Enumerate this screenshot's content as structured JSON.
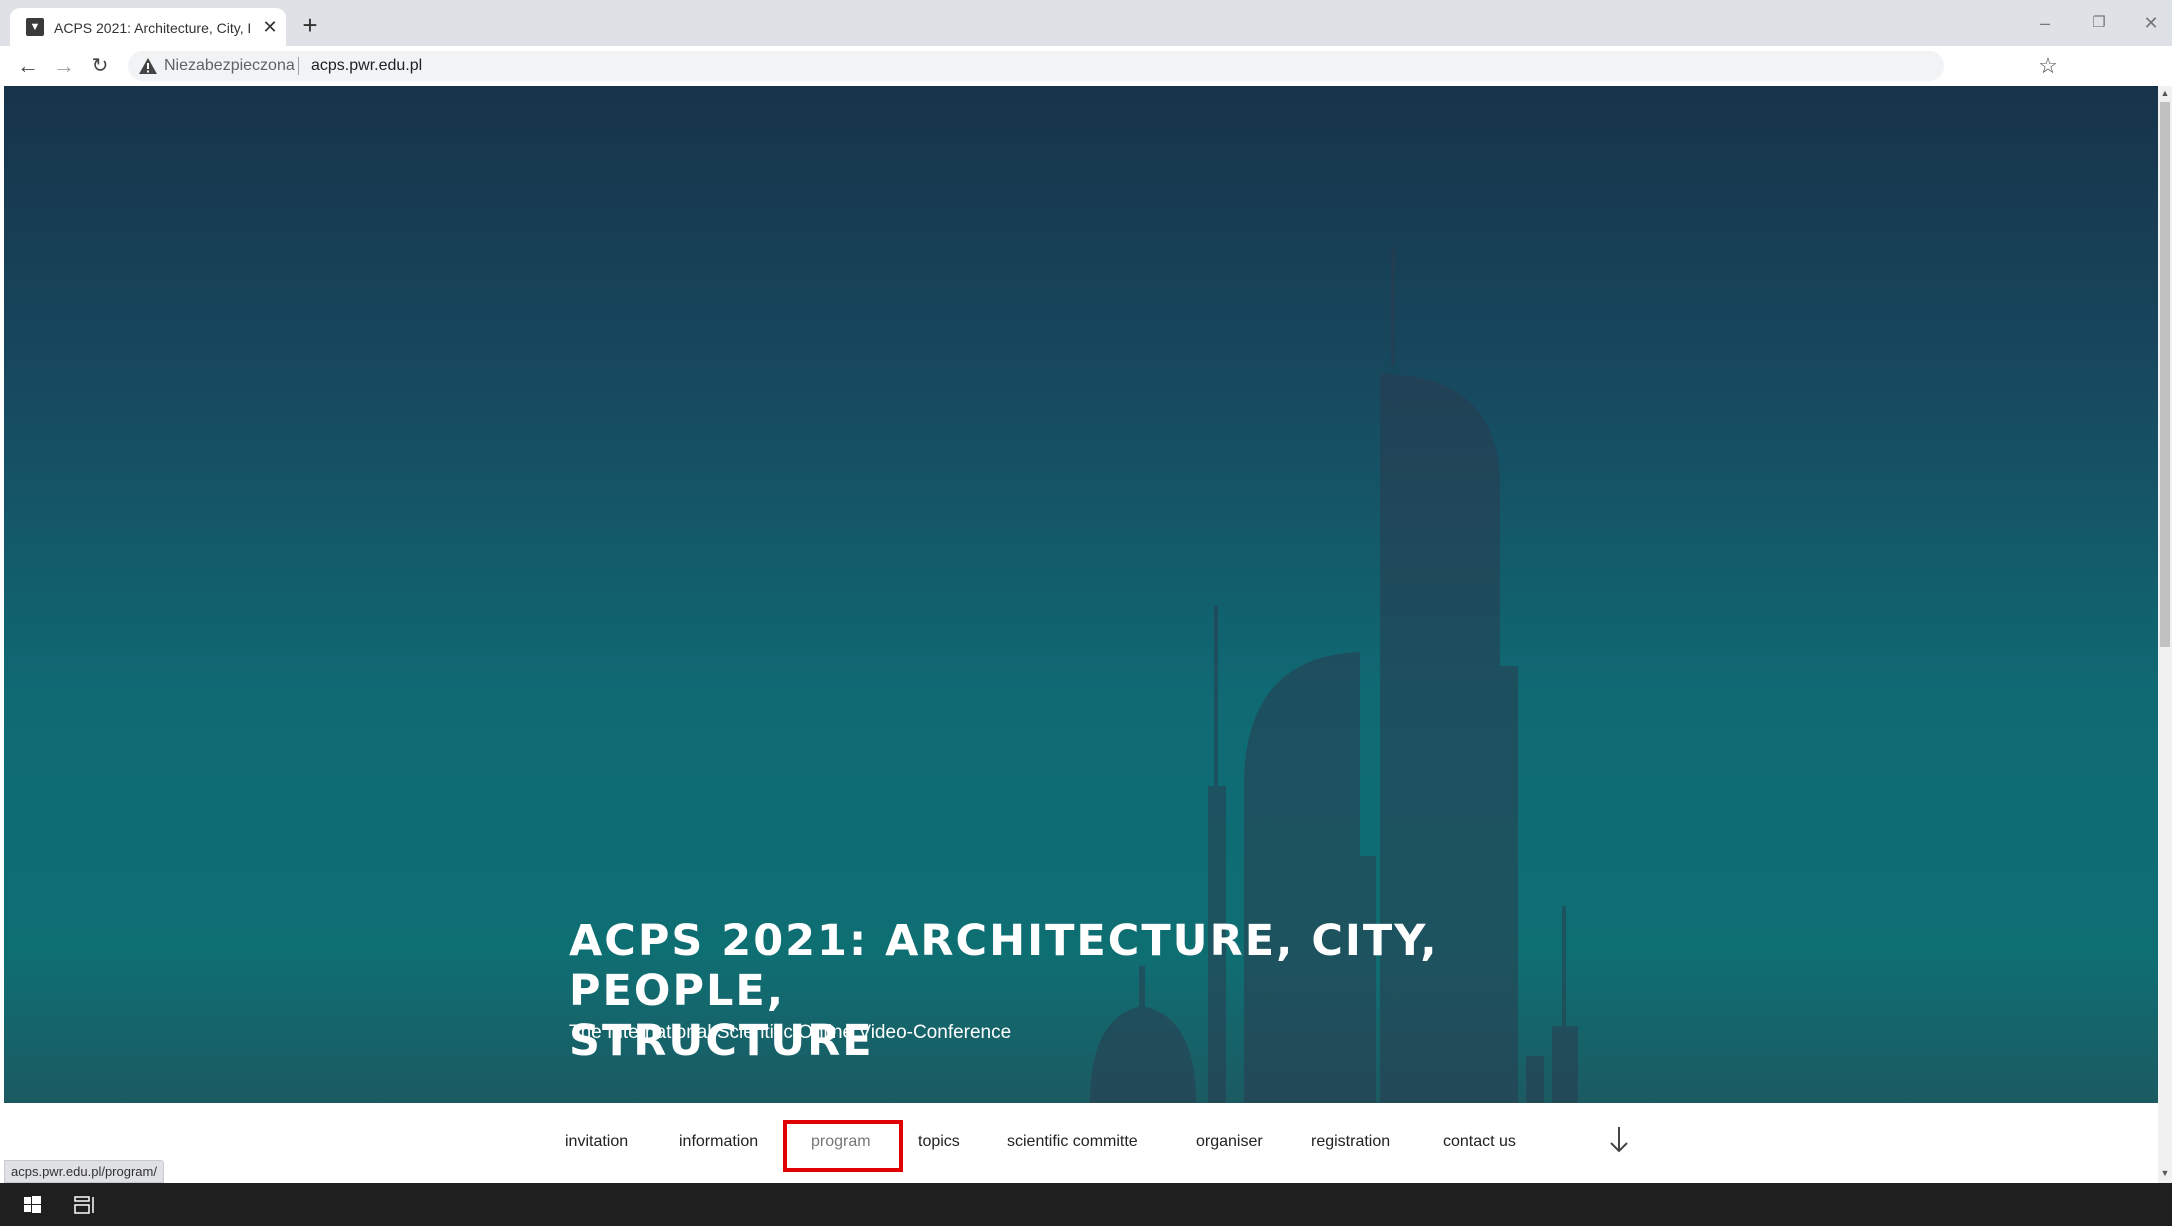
{
  "browser": {
    "tab_title": "ACPS 2021: Architecture, City, Pe",
    "tab_close": "✕",
    "new_tab": "+",
    "security_label": "Niezabezpieczona",
    "url": "acps.pwr.edu.pl",
    "icons": [
      "back-icon",
      "forward-icon",
      "reload-icon",
      "warning-icon",
      "star-icon",
      "minimize-icon",
      "restore-icon",
      "close-icon"
    ]
  },
  "hero": {
    "title_line1": "ACPS 2021: ARCHITECTURE, CITY, PEOPLE,",
    "title_line2": "STRUCTURE",
    "subtitle": "The International Scientific Online Video-Conference"
  },
  "menu": {
    "items": [
      {
        "label": "invitation"
      },
      {
        "label": "information"
      },
      {
        "label": "program"
      },
      {
        "label": "topics"
      },
      {
        "label": "scientific committe"
      },
      {
        "label": "organiser"
      },
      {
        "label": "registration"
      },
      {
        "label": "contact us"
      }
    ],
    "active": "program"
  },
  "status_bar": {
    "link": "acps.pwr.edu.pl/program/"
  },
  "colors": {
    "annotation": "#e00000",
    "hero_top": "#17334a",
    "hero_bottom": "#0e6f73"
  }
}
